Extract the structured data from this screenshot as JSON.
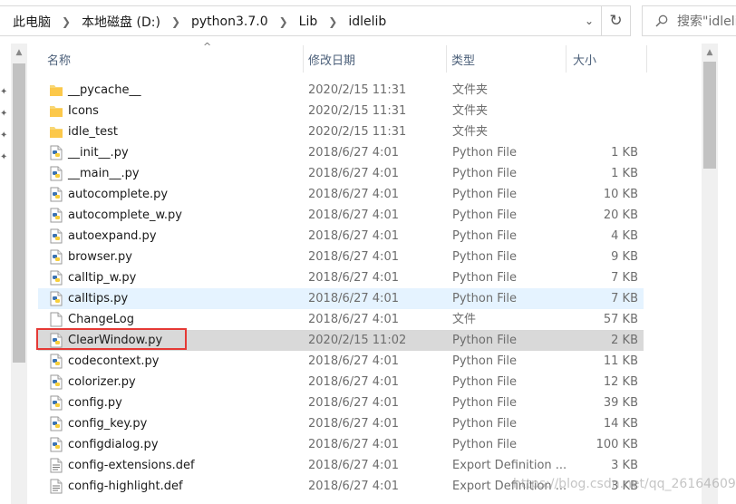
{
  "address": {
    "crumbs": [
      "此电脑",
      "本地磁盘 (D:)",
      "python3.7.0",
      "Lib",
      "idlelib"
    ],
    "search_placeholder": "搜索\"idlelib\""
  },
  "columns": {
    "name": "名称",
    "date": "修改日期",
    "type": "类型",
    "size": "大小"
  },
  "files": [
    {
      "name": "__pycache__",
      "date": "2020/2/15 11:31",
      "type": "文件夹",
      "size": "",
      "icon": "folder-icon",
      "state": ""
    },
    {
      "name": "Icons",
      "date": "2020/2/15 11:31",
      "type": "文件夹",
      "size": "",
      "icon": "folder-icon",
      "state": ""
    },
    {
      "name": "idle_test",
      "date": "2020/2/15 11:31",
      "type": "文件夹",
      "size": "",
      "icon": "folder-icon",
      "state": ""
    },
    {
      "name": "__init__.py",
      "date": "2018/6/27 4:01",
      "type": "Python File",
      "size": "1 KB",
      "icon": "python-file-icon",
      "state": ""
    },
    {
      "name": "__main__.py",
      "date": "2018/6/27 4:01",
      "type": "Python File",
      "size": "1 KB",
      "icon": "python-file-icon",
      "state": ""
    },
    {
      "name": "autocomplete.py",
      "date": "2018/6/27 4:01",
      "type": "Python File",
      "size": "10 KB",
      "icon": "python-file-icon",
      "state": ""
    },
    {
      "name": "autocomplete_w.py",
      "date": "2018/6/27 4:01",
      "type": "Python File",
      "size": "20 KB",
      "icon": "python-file-icon",
      "state": ""
    },
    {
      "name": "autoexpand.py",
      "date": "2018/6/27 4:01",
      "type": "Python File",
      "size": "4 KB",
      "icon": "python-file-icon",
      "state": ""
    },
    {
      "name": "browser.py",
      "date": "2018/6/27 4:01",
      "type": "Python File",
      "size": "9 KB",
      "icon": "python-file-icon",
      "state": ""
    },
    {
      "name": "calltip_w.py",
      "date": "2018/6/27 4:01",
      "type": "Python File",
      "size": "7 KB",
      "icon": "python-file-icon",
      "state": ""
    },
    {
      "name": "calltips.py",
      "date": "2018/6/27 4:01",
      "type": "Python File",
      "size": "7 KB",
      "icon": "python-file-icon",
      "state": "hover"
    },
    {
      "name": "ChangeLog",
      "date": "2018/6/27 4:01",
      "type": "文件",
      "size": "57 KB",
      "icon": "blank-file-icon",
      "state": ""
    },
    {
      "name": "ClearWindow.py",
      "date": "2020/2/15 11:02",
      "type": "Python File",
      "size": "2 KB",
      "icon": "python-file-icon",
      "state": "selected"
    },
    {
      "name": "codecontext.py",
      "date": "2018/6/27 4:01",
      "type": "Python File",
      "size": "11 KB",
      "icon": "python-file-icon",
      "state": ""
    },
    {
      "name": "colorizer.py",
      "date": "2018/6/27 4:01",
      "type": "Python File",
      "size": "12 KB",
      "icon": "python-file-icon",
      "state": ""
    },
    {
      "name": "config.py",
      "date": "2018/6/27 4:01",
      "type": "Python File",
      "size": "39 KB",
      "icon": "python-file-icon",
      "state": ""
    },
    {
      "name": "config_key.py",
      "date": "2018/6/27 4:01",
      "type": "Python File",
      "size": "14 KB",
      "icon": "python-file-icon",
      "state": ""
    },
    {
      "name": "configdialog.py",
      "date": "2018/6/27 4:01",
      "type": "Python File",
      "size": "100 KB",
      "icon": "python-file-icon",
      "state": ""
    },
    {
      "name": "config-extensions.def",
      "date": "2018/6/27 4:01",
      "type": "Export Definition ...",
      "size": "3 KB",
      "icon": "def-file-icon",
      "state": ""
    },
    {
      "name": "config-highlight.def",
      "date": "2018/6/27 4:01",
      "type": "Export Definition ...",
      "size": "3 KB",
      "icon": "def-file-icon",
      "state": ""
    }
  ],
  "watermark": "https://blog.csdn.net/qq_26164609",
  "colors": {
    "header_text": "#4c607a",
    "hover_row": "#e5f3ff",
    "selected_row": "#d9d9d9",
    "highlight_box": "#e53935"
  }
}
